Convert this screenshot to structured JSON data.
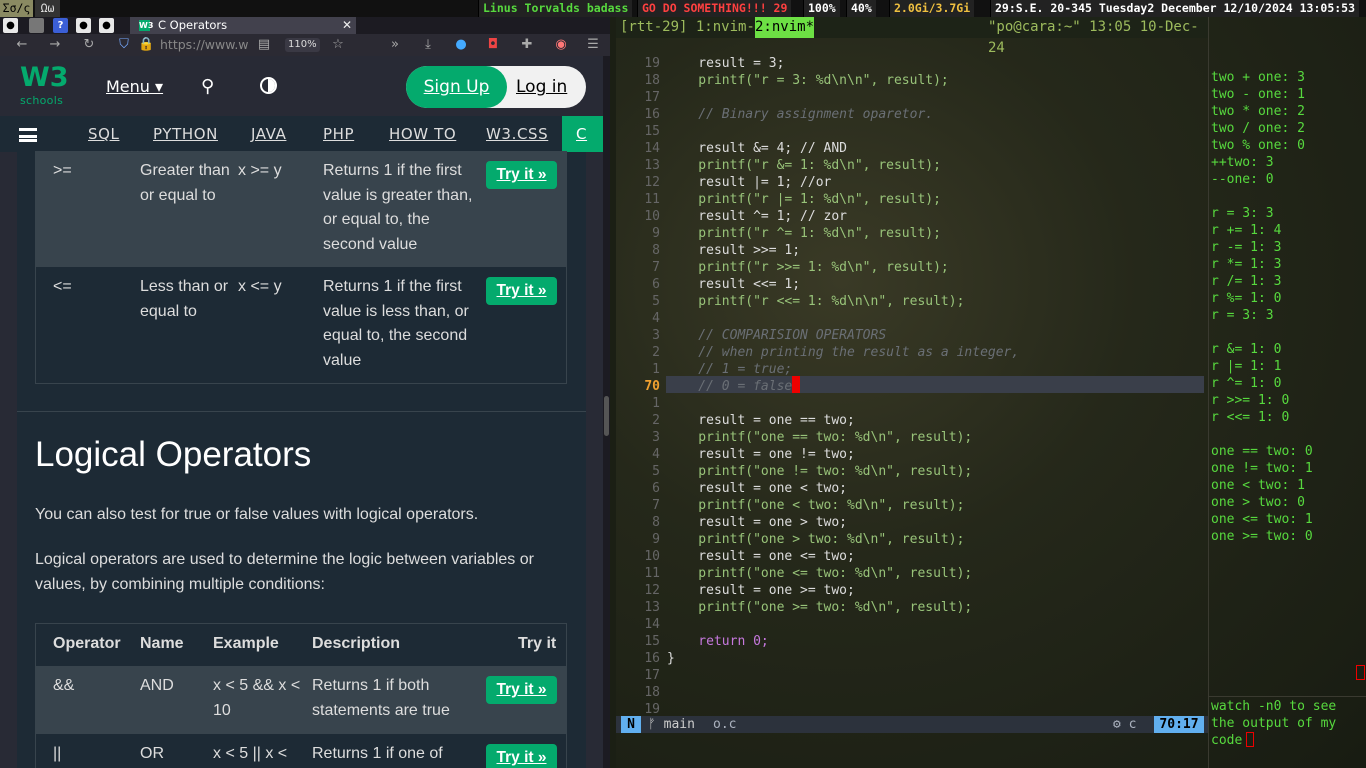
{
  "topbar": {
    "workspaces": [
      "Σσ/ς",
      "Ωω"
    ],
    "segments": [
      {
        "text": "Linus Torvalds badass",
        "color": "#57d93e"
      },
      {
        "text": "GO DO SOMETHING!!! 29",
        "color": "#ff4040"
      },
      {
        "text": "100%",
        "color": "#ffffff"
      },
      {
        "text": "40%",
        "color": "#ffffff"
      },
      {
        "text": "2.0Gi/3.7Gi",
        "color": "#f0c040"
      },
      {
        "text": "29:S.E. 20-345 Tuesday2 December 12/10/2024 13:05:53",
        "color": "#ffffff"
      }
    ]
  },
  "browser": {
    "tab_icons": [
      "github-icon",
      "unknown-icon",
      "help-icon",
      "github-icon",
      "github-icon"
    ],
    "tab_title": "C Operators",
    "tab_favicon": "W3",
    "url": "https://www.w",
    "zoom": "110%"
  },
  "w3": {
    "logo_main": "W3",
    "logo_sub": "schools",
    "menu": "Menu",
    "signup": "Sign Up",
    "login": "Log in",
    "nav": [
      "SQL",
      "PYTHON",
      "JAVA",
      "PHP",
      "HOW TO",
      "W3.CSS",
      "C"
    ],
    "try_label": "Try it »",
    "comp_rows": [
      {
        "op": ">=",
        "name": "Greater than or equal to",
        "example": "x >= y",
        "desc": "Returns 1 if the first value is greater than, or equal to, the second value"
      },
      {
        "op": "<=",
        "name": "Less than or equal to",
        "example": "x <= y",
        "desc": "Returns 1 if the first value is less than, or equal to, the second value"
      }
    ],
    "heading": "Logical Operators",
    "para1": "You can also test for true or false values with logical operators.",
    "para2": "Logical operators are used to determine the logic between variables or values, by combining multiple conditions:",
    "logic_headers": [
      "Operator",
      "Name",
      "Example",
      "Description",
      "Try it"
    ],
    "logic_rows": [
      {
        "op": "&&",
        "name": "AND",
        "example": "x < 5 &&  x < 10",
        "desc": "Returns 1 if both statements are true"
      },
      {
        "op": "||",
        "name": "OR",
        "example": "x < 5 || x <",
        "desc": "Returns 1 if one of"
      }
    ]
  },
  "term": {
    "tmux_left": "[rtt-29] 1:nvim- ",
    "tmux_active": "2:nvim*",
    "tmux_right": "\"po@cara:~\" 13:05 10-Dec-24",
    "gutter": [
      "19",
      "18",
      "17",
      "16",
      "15",
      "14",
      "13",
      "12",
      "11",
      "10",
      "9",
      "8",
      "7",
      "6",
      "5",
      "4",
      "3",
      "2",
      "1",
      "70",
      "1",
      "2",
      "3",
      "4",
      "5",
      "6",
      "7",
      "8",
      "9",
      "10",
      "11",
      "12",
      "13",
      "14",
      "15",
      "16",
      "17",
      "18",
      "19"
    ],
    "code": [
      "    result = 3;",
      "    printf(\"r = 3: %d\\n\\n\", result);",
      "",
      "    // Binary assignment oparetor.",
      "",
      "    result &= 4; // AND",
      "    printf(\"r &= 1: %d\\n\", result);",
      "    result |= 1; //or",
      "    printf(\"r |= 1: %d\\n\", result);",
      "    result ^= 1; // zor",
      "    printf(\"r ^= 1: %d\\n\", result);",
      "    result >>= 1;",
      "    printf(\"r >>= 1: %d\\n\", result);",
      "    result <<= 1;",
      "    printf(\"r <<= 1: %d\\n\\n\", result);",
      "",
      "    // COMPARISION OPERATORS",
      "    // when printing the result as a integer,",
      "    // 1 = true;",
      "    // 0 = false",
      "",
      "    result = one == two;",
      "    printf(\"one == two: %d\\n\", result);",
      "    result = one != two;",
      "    printf(\"one != two: %d\\n\", result);",
      "    result = one < two;",
      "    printf(\"one < two: %d\\n\", result);",
      "    result = one > two;",
      "    printf(\"one > two: %d\\n\", result);",
      "    result = one <= two;",
      "    printf(\"one <= two: %d\\n\", result);",
      "    result = one >= two;",
      "    printf(\"one >= two: %d\\n\", result);",
      "",
      "    return 0;",
      "}",
      "",
      "",
      ""
    ],
    "status_mode": "N",
    "status_branch": "ᚠ main",
    "status_file": "o.c",
    "status_ft": "⚙ c",
    "status_pos": "70:17",
    "output": [
      "two + one: 3",
      "two - one: 1",
      "two * one: 2",
      "two / one: 2",
      "two % one: 0",
      "++two: 3",
      "--one: 0",
      "",
      "r = 3: 3",
      "r += 1: 4",
      "r -= 1: 3",
      "r *= 1: 3",
      "r /= 1: 3",
      "r %= 1: 0",
      "r = 3: 3",
      "",
      "r &= 1: 0",
      "r |= 1: 1",
      "r ^= 1: 0",
      "r >>= 1: 0",
      "r <<= 1: 0",
      "",
      "one == two: 0",
      "one != two: 1",
      "one < two: 1",
      "one > two: 0",
      "one <= two: 1",
      "one >= two: 0"
    ],
    "note": "watch -n0 to see\nthe output of my\ncode"
  }
}
